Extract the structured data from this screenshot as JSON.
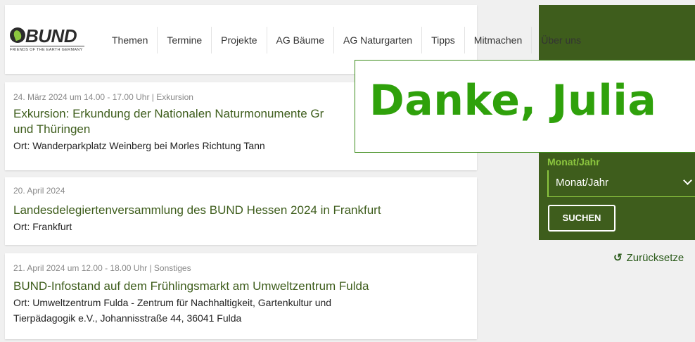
{
  "logo": {
    "word": "BUND",
    "tagline": "FRIENDS OF THE EARTH GERMANY"
  },
  "nav": [
    "Themen",
    "Termine",
    "Projekte",
    "AG Bäume",
    "AG Naturgarten",
    "Tipps",
    "Mitmachen",
    "Über uns"
  ],
  "events": [
    {
      "meta": "24. März 2024 um 14.00 - 17.00 Uhr | Exkursion",
      "title_line1": "Exkursion: Erkundung der Nationalen Naturmonumente Gr",
      "title_line2": "und Thüringen",
      "place": "Ort: Wanderparkplatz Weinberg bei Morles Richtung Tann"
    },
    {
      "meta": "20. April 2024",
      "title_line1": "Landesdelegiertenversammlung des BUND Hessen 2024 in Frankfurt",
      "place": "Ort: Frankfurt"
    },
    {
      "meta": "21. April 2024 um 12.00 - 18.00 Uhr | Sonstiges",
      "title_line1": "BUND-Infostand auf dem Frühlingsmarkt am Umweltzentrum Fulda",
      "place": "Ort: Umweltzentrum Fulda - Zentrum für Nachhaltigkeit, Gartenkultur und",
      "place_line2": "Tierpädagogik e.V., Johannisstraße 44, 36041 Fulda"
    }
  ],
  "filter": {
    "label": "Monat/Jahr",
    "selected": "Monat/Jahr",
    "search_label": "SUCHEN",
    "reset_label": "Zurücksetze"
  },
  "banner": {
    "text": "Danke, Julia"
  },
  "colors": {
    "brand_green": "#3e5d1c",
    "accent_green": "#8cc63f",
    "banner_green": "#2fa10b"
  }
}
